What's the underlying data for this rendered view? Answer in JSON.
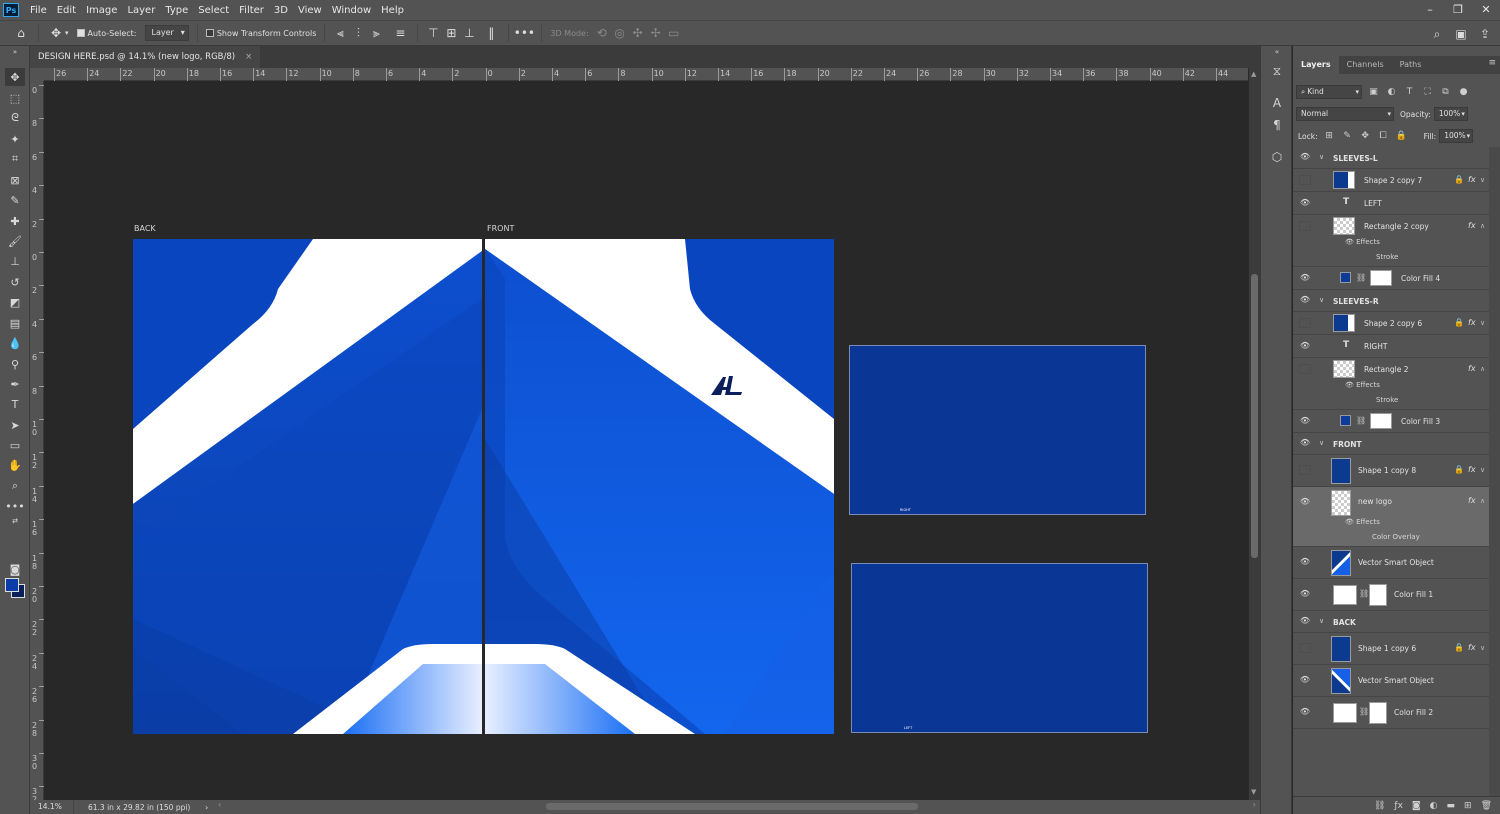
{
  "menubar": {
    "app_icon": "Ps",
    "items": [
      "File",
      "Edit",
      "Image",
      "Layer",
      "Type",
      "Select",
      "Filter",
      "3D",
      "View",
      "Window",
      "Help"
    ]
  },
  "options": {
    "auto_select_label": "Auto-Select:",
    "auto_select_target": "Layer",
    "show_transform_label": "Show Transform Controls",
    "mode_3d_label": "3D Mode:"
  },
  "document": {
    "tab_title": "DESIGN HERE.psd @ 14.1% (new logo, RGB/8)",
    "close_glyph": "×"
  },
  "rulers": {
    "top_labels": [
      "26",
      "24",
      "22",
      "20",
      "18",
      "16",
      "14",
      "12",
      "10",
      "8",
      "6",
      "4",
      "2",
      "0",
      "2",
      "4",
      "6",
      "8",
      "10",
      "12",
      "14",
      "16",
      "18",
      "20",
      "22",
      "24",
      "26",
      "28",
      "30",
      "32",
      "34",
      "36",
      "38",
      "40",
      "42",
      "44"
    ],
    "left_labels": [
      "0",
      "8",
      "6",
      "4",
      "2",
      "0",
      "2",
      "4",
      "6",
      "8",
      "1\n0",
      "1\n2",
      "1\n4",
      "1\n6",
      "1\n8",
      "2\n0",
      "2\n2",
      "2\n4",
      "2\n6",
      "2\n8",
      "3\n0",
      "3\n2"
    ]
  },
  "canvas": {
    "back_label": "BACK",
    "front_label": "FRONT",
    "sleeve_right_tag": "RIGHT",
    "sleeve_left_tag": "LEFT",
    "logo_text": "AL"
  },
  "status": {
    "zoom": "14.1%",
    "doc_size": "61.3 in x 29.82 in (150 ppi)"
  },
  "layers_panel": {
    "tabs": [
      "Layers",
      "Channels",
      "Paths"
    ],
    "filter_kind": "Kind",
    "blend_mode": "Normal",
    "opacity_label": "Opacity:",
    "opacity_value": "100%",
    "lock_label": "Lock:",
    "fill_label": "Fill:",
    "fill_value": "100%",
    "groups": {
      "sleeves_l": "SLEEVES-L",
      "sleeves_r": "SLEEVES-R",
      "front": "FRONT",
      "back": "BACK"
    },
    "layers": {
      "l_shape": "Shape 2 copy 7",
      "l_text": "LEFT",
      "l_rect": "Rectangle 2 copy",
      "l_fill": "Color Fill 4",
      "r_shape": "Shape 2 copy 6",
      "r_text": "RIGHT",
      "r_rect": "Rectangle 2",
      "r_fill": "Color Fill 3",
      "f_shape": "Shape 1 copy 8",
      "f_logo": "new logo",
      "f_vector": "Vector Smart Object",
      "f_fill": "Color Fill 1",
      "b_shape": "Shape 1 copy 6",
      "b_vector": "Vector Smart Object",
      "b_fill": "Color Fill 2"
    },
    "effects_label": "Effects",
    "stroke_label": "Stroke",
    "color_overlay_label": "Color Overlay",
    "fx_label": "fx",
    "text_layer_glyph": "T"
  },
  "colors": {
    "ui_panel": "#535353",
    "canvas_bg": "#282828",
    "jersey_blue_light": "#1a6df0",
    "jersey_blue_mid": "#0d4fcf",
    "jersey_blue_dark": "#072d8a",
    "sleeve_blue": "#0a3696"
  }
}
